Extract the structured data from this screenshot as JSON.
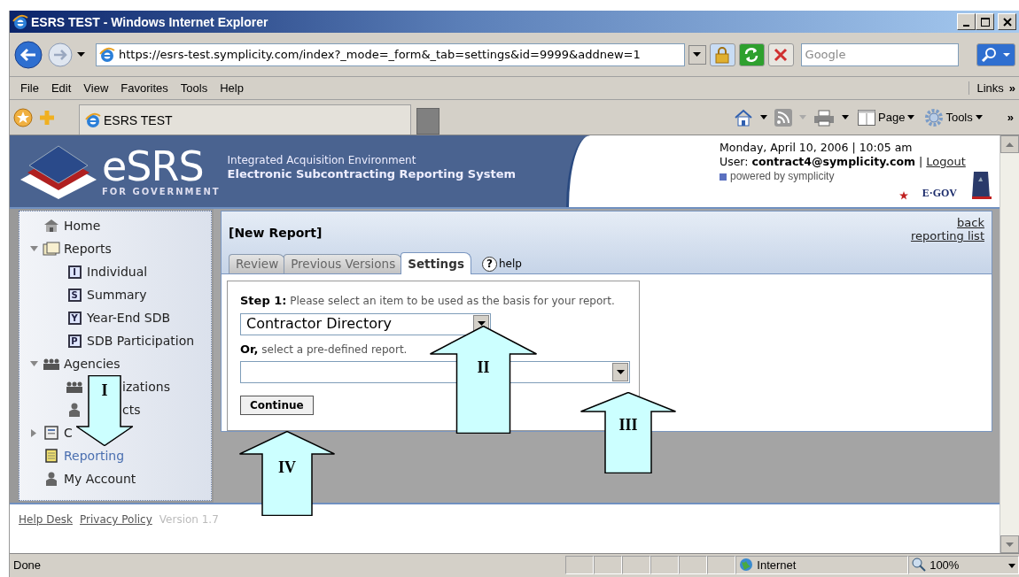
{
  "window": {
    "title": "ESRS TEST - Windows Internet Explorer"
  },
  "address_bar": {
    "url": "https://esrs-test.symplicity.com/index?_mode=_form&_tab=settings&id=9999&addnew=1"
  },
  "search": {
    "placeholder": "Google"
  },
  "menu": [
    "File",
    "Edit",
    "View",
    "Favorites",
    "Tools",
    "Help"
  ],
  "links_bar": {
    "label": "Links",
    "more": "»"
  },
  "browser_tabs": [
    {
      "label": "ESRS TEST",
      "selected": true
    }
  ],
  "command_bar": {
    "page": "Page",
    "tools": "Tools",
    "more": "»"
  },
  "site_header": {
    "logo_text": "eSRS",
    "logo_subtext": "FOR GOVERNMENT",
    "subtitle": "Integrated Acquisition Environment",
    "title": "Electronic Subcontracting Reporting System",
    "date": "Monday, April 10, 2006 | 10:05 am",
    "user_line": "User: **contract4@symplicity.com** |",
    "logout": "Logout",
    "powered_by": "powered by symplicity",
    "egov": "E·GOV"
  },
  "sidebar": {
    "items": [
      {
        "label": "Home",
        "kind": "home",
        "selected": false
      },
      {
        "label": "Reports",
        "kind": "folder",
        "selected": false,
        "expanded": true,
        "children": [
          {
            "label": "Individual",
            "kind": "letter",
            "letter": "I",
            "selected": false
          },
          {
            "label": "Summary",
            "kind": "letter",
            "letter": "S",
            "selected": false
          },
          {
            "label": "Year-End SDB",
            "kind": "letter",
            "letter": "Y",
            "selected": false
          },
          {
            "label": "SDB Participation",
            "kind": "letter",
            "letter": "P",
            "selected": false
          }
        ]
      },
      {
        "label": "Agencies",
        "kind": "people",
        "selected": false,
        "expanded": true,
        "children": [
          {
            "label": "izations",
            "kind": "people",
            "selected": false,
            "covered": true
          },
          {
            "label": "cts",
            "kind": "person",
            "selected": false,
            "covered": true
          }
        ]
      },
      {
        "label": "C",
        "kind": "clipboard",
        "selected": false,
        "expanded": false
      },
      {
        "label": "Reporting",
        "kind": "notebook",
        "selected": true
      },
      {
        "label": "My Account",
        "kind": "person",
        "selected": false
      }
    ]
  },
  "panel": {
    "title": "[New Report]",
    "links": [
      "back",
      "reporting list"
    ],
    "tabs": [
      {
        "label": "Review",
        "selected": false
      },
      {
        "label": "Previous Versions",
        "selected": false
      },
      {
        "label": "Settings",
        "selected": true
      }
    ],
    "help": {
      "icon": "?",
      "label": "help"
    },
    "form": {
      "step_text": "**Step 1:** Please select an item to be used as the basis for your report.",
      "select_value": "Contractor Directory",
      "or_text": "**Or,** select a pre-defined report.",
      "button": "Continue"
    }
  },
  "footer": {
    "links": [
      "Help Desk",
      "Privacy Policy"
    ],
    "version": "Version 1.7"
  },
  "status_bar": {
    "text": "Done",
    "zone": "Internet",
    "zoom": "100%"
  },
  "annotations": [
    {
      "label": "I",
      "kind": "down_arrow"
    },
    {
      "label": "II",
      "kind": "up_arrow"
    },
    {
      "label": "III",
      "kind": "up_arrow"
    },
    {
      "label": "IV",
      "kind": "up_arrow"
    }
  ]
}
